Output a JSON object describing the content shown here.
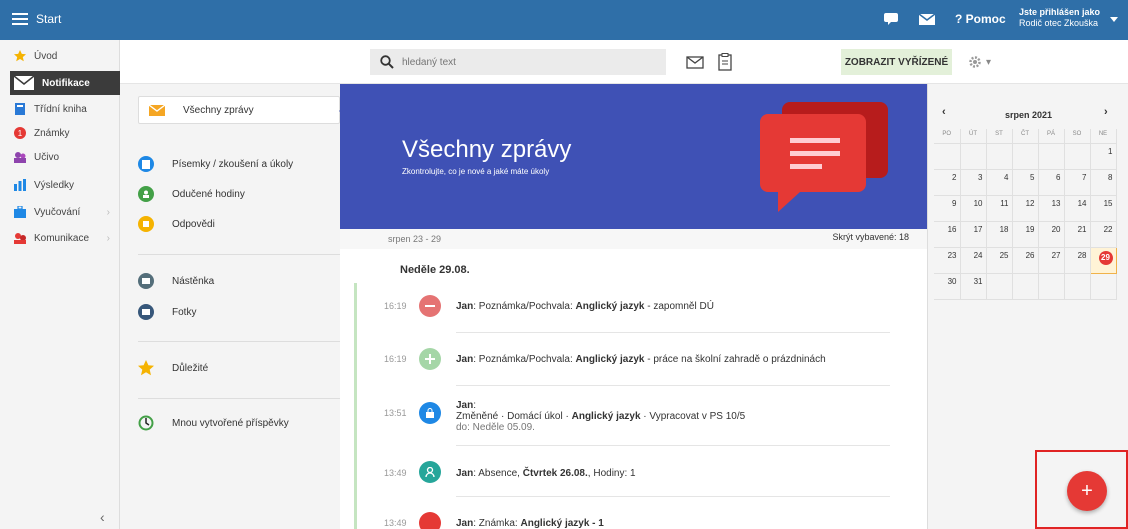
{
  "topbar": {
    "start_label": "Start",
    "help_label": "Pomoc",
    "user_line1": "Jste přihlášen jako",
    "user_line2": "Rodič otec Zkouška"
  },
  "sidebar": {
    "items": [
      {
        "label": "Úvod",
        "icon": "star-icon"
      },
      {
        "label": "Notifikace",
        "icon": "envelope-icon"
      },
      {
        "label": "Třídní kniha",
        "icon": "book-icon"
      },
      {
        "label": "Známky",
        "icon": "grade-icon"
      },
      {
        "label": "Učivo",
        "icon": "people-icon"
      },
      {
        "label": "Výsledky",
        "icon": "bar-chart-icon"
      },
      {
        "label": "Vyučování",
        "icon": "briefcase-icon"
      },
      {
        "label": "Komunikace",
        "icon": "chat-people-icon"
      }
    ]
  },
  "toolbar": {
    "search_placeholder": "hledaný text",
    "resolved_label": "ZOBRAZIT VYŘÍZENÉ"
  },
  "categories": [
    {
      "label": "Všechny zprávy"
    },
    {
      "label": "Písemky / zkoušení a úkoly"
    },
    {
      "label": "Odučené hodiny"
    },
    {
      "label": "Odpovědi"
    },
    {
      "label": "Nástěnka"
    },
    {
      "label": "Fotky"
    },
    {
      "label": "Důležité"
    },
    {
      "label": "Mnou vytvořené příspěvky"
    }
  ],
  "hero": {
    "title": "Všechny zprávy",
    "subtitle": "Zkontrolujte, co je nové a jaké máte úkoly"
  },
  "week": {
    "range": "srpen 23 - 29",
    "hide_selected": "Skrýt vybavené: 18"
  },
  "day_label": "Neděle 29.08.",
  "messages": [
    {
      "time": "16:19",
      "who": "Jan",
      "type": "Poznámka/Pochvala",
      "subject": "Anglický jazyk",
      "text": "zapomněl DÚ",
      "color": "#e57373"
    },
    {
      "time": "16:19",
      "who": "Jan",
      "type": "Poznámka/Pochvala",
      "subject": "Anglický jazyk",
      "text": "práce na školní zahradě o prázdninách",
      "color": "#a5d6a7"
    },
    {
      "time": "13:51",
      "who": "Jan",
      "type": "Změněné",
      "kind": "Domácí úkol",
      "subject": "Anglický jazyk",
      "text": "Vypracovat v PS 10/5",
      "due": "do: Neděle 05.09.",
      "color": "#1e88e5"
    },
    {
      "time": "13:49",
      "who": "Jan",
      "type": "Absence",
      "day": "Čtvrtek 26.08.",
      "text": "Hodiny: 1",
      "color": "#26a69a"
    },
    {
      "time": "13:49",
      "who": "Jan",
      "type": "Známka",
      "subject": "Anglický jazyk - 1",
      "color": "#e53935"
    }
  ],
  "calendar": {
    "month": "srpen 2021",
    "prev": "‹",
    "next": "›",
    "weekdays": [
      "PO",
      "ÚT",
      "ST",
      "ČT",
      "PÁ",
      "SO",
      "NE"
    ],
    "weeks": [
      [
        "",
        "",
        "",
        "",
        "",
        "",
        "1"
      ],
      [
        "2",
        "3",
        "4",
        "5",
        "6",
        "7",
        "8"
      ],
      [
        "9",
        "10",
        "11",
        "12",
        "13",
        "14",
        "15"
      ],
      [
        "16",
        "17",
        "18",
        "19",
        "20",
        "21",
        "22"
      ],
      [
        "23",
        "24",
        "25",
        "26",
        "27",
        "28",
        "29"
      ],
      [
        "30",
        "31",
        "",
        "",
        "",
        "",
        ""
      ]
    ],
    "today": "29"
  },
  "fab_label": "+",
  "colors": {
    "topbar": "#2f6fa8",
    "hero": "#3f51b5",
    "accent_red": "#e53935",
    "resolved_bg": "#e3f0d9"
  }
}
